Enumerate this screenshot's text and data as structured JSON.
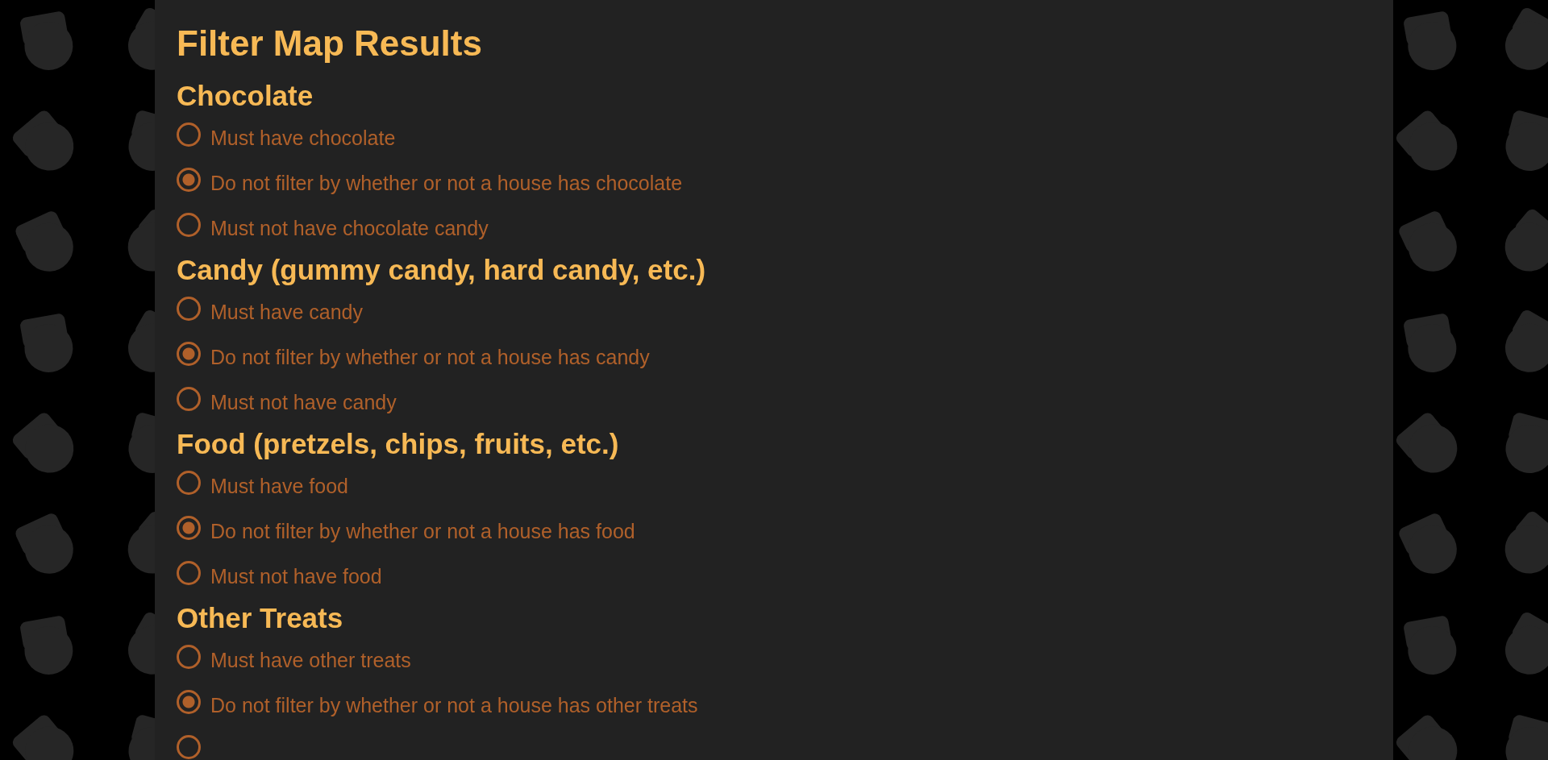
{
  "title": "Filter Map Results",
  "sections": [
    {
      "heading": "Chocolate",
      "options": [
        {
          "label": "Must have chocolate",
          "selected": false
        },
        {
          "label": "Do not filter by whether or not a house has chocolate",
          "selected": true
        },
        {
          "label": "Must not have chocolate candy",
          "selected": false
        }
      ]
    },
    {
      "heading": "Candy (gummy candy, hard candy, etc.)",
      "options": [
        {
          "label": "Must have candy",
          "selected": false
        },
        {
          "label": "Do not filter by whether or not a house has candy",
          "selected": true
        },
        {
          "label": "Must not have candy",
          "selected": false
        }
      ]
    },
    {
      "heading": "Food (pretzels, chips, fruits, etc.)",
      "options": [
        {
          "label": "Must have food",
          "selected": false
        },
        {
          "label": "Do not filter by whether or not a house has food",
          "selected": true
        },
        {
          "label": "Must not have food",
          "selected": false
        }
      ]
    },
    {
      "heading": "Other Treats",
      "options": [
        {
          "label": "Must have other treats",
          "selected": false
        },
        {
          "label": "Do not filter by whether or not a house has other treats",
          "selected": true
        },
        {
          "selected": false
        }
      ]
    }
  ]
}
